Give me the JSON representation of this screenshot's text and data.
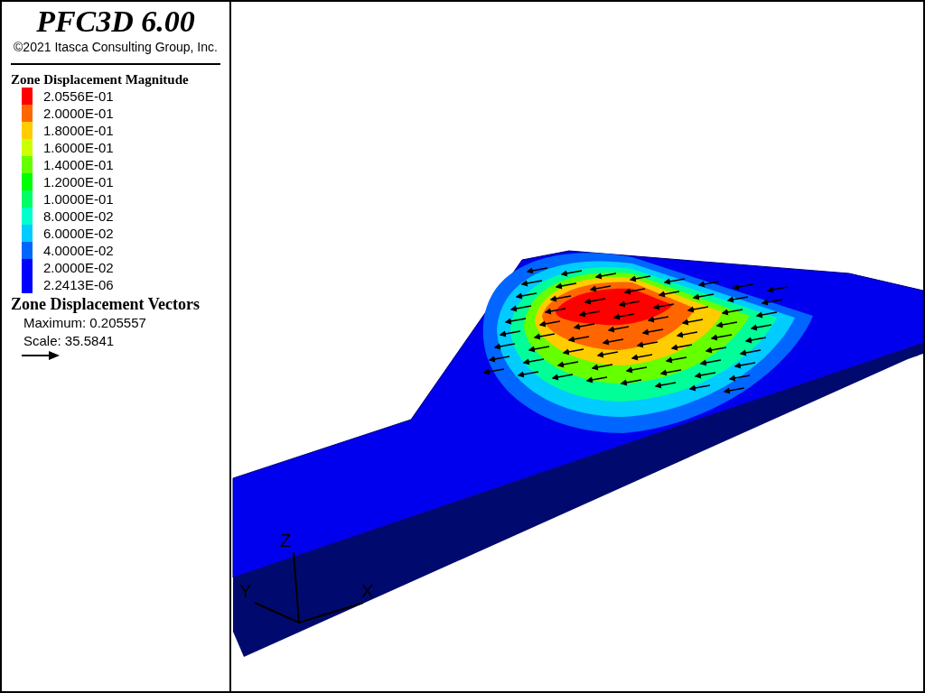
{
  "header": {
    "title": "PFC3D 6.00",
    "copyright": "©2021 Itasca Consulting Group, Inc."
  },
  "magnitude_legend": {
    "title": "Zone Displacement Magnitude",
    "entries": [
      {
        "label": "2.0556E-01",
        "color": "#ff0000"
      },
      {
        "label": "2.0000E-01",
        "color": "#ff6600"
      },
      {
        "label": "1.8000E-01",
        "color": "#ffcc00"
      },
      {
        "label": "1.6000E-01",
        "color": "#ccff00"
      },
      {
        "label": "1.4000E-01",
        "color": "#66ff00"
      },
      {
        "label": "1.2000E-01",
        "color": "#00ff00"
      },
      {
        "label": "1.0000E-01",
        "color": "#00ff66"
      },
      {
        "label": "8.0000E-02",
        "color": "#00ffcc"
      },
      {
        "label": "6.0000E-02",
        "color": "#00ccff"
      },
      {
        "label": "4.0000E-02",
        "color": "#0066ff"
      },
      {
        "label": "2.0000E-02",
        "color": "#0000ff"
      },
      {
        "label": "2.2413E-06",
        "color": "#0000ff"
      }
    ]
  },
  "vector_legend": {
    "title": "Zone Displacement Vectors",
    "maximum": "Maximum: 0.205557",
    "scale": "Scale: 35.5841"
  },
  "axes": {
    "x": "X",
    "y": "Y",
    "z": "Z"
  }
}
